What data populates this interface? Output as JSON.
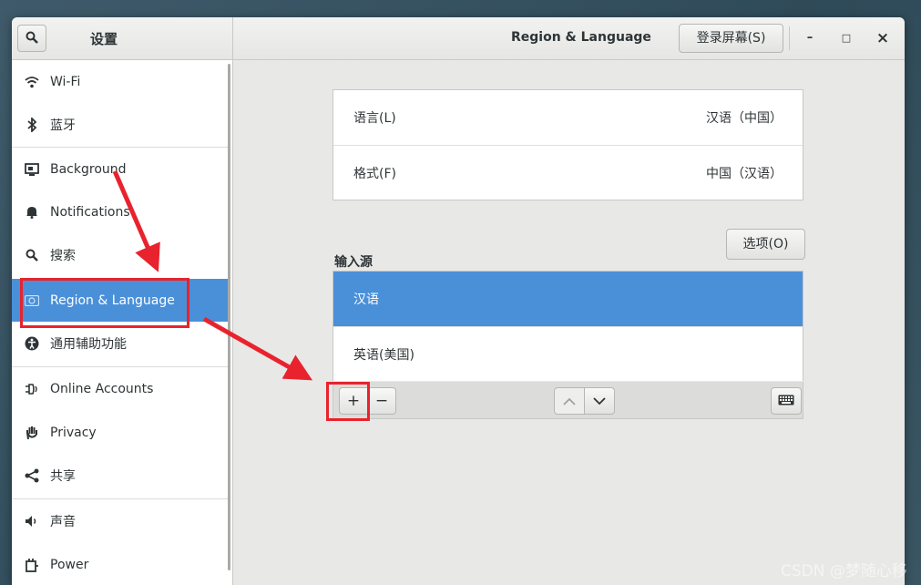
{
  "window": {
    "settings_title": "设置",
    "page_title": "Region & Language",
    "login_screen_button": "登录屏幕(S)",
    "minimize_symbol": "–",
    "maximize_symbol": "□",
    "close_symbol": "×"
  },
  "sidebar": {
    "items": [
      {
        "label": "Wi-Fi",
        "icon": "wifi-icon"
      },
      {
        "label": "蓝牙",
        "icon": "bluetooth-icon"
      },
      {
        "label": "Background",
        "icon": "background-icon"
      },
      {
        "label": "Notifications",
        "icon": "bell-icon"
      },
      {
        "label": "搜索",
        "icon": "search-icon"
      },
      {
        "label": "Region & Language",
        "icon": "region-icon",
        "selected": true
      },
      {
        "label": "通用辅助功能",
        "icon": "accessibility-icon"
      },
      {
        "label": "Online Accounts",
        "icon": "online-accounts-icon"
      },
      {
        "label": "Privacy",
        "icon": "hand-icon"
      },
      {
        "label": "共享",
        "icon": "share-icon"
      },
      {
        "label": "声音",
        "icon": "speaker-icon"
      },
      {
        "label": "Power",
        "icon": "power-icon"
      }
    ]
  },
  "main": {
    "language": {
      "label": "语言(L)",
      "value": "汉语（中国）"
    },
    "formats": {
      "label": "格式(F)",
      "value": "中国（汉语）"
    },
    "input_sources_label": "输入源",
    "options_button": "选项(O)",
    "input_sources": [
      {
        "label": "汉语",
        "selected": true
      },
      {
        "label": "英语(美国)",
        "selected": false
      }
    ],
    "toolbar": {
      "add": "+",
      "remove": "−"
    }
  },
  "watermark": "CSDN @梦随心移",
  "colors": {
    "accent": "#4a90d9",
    "annotation": "#e8232d"
  }
}
